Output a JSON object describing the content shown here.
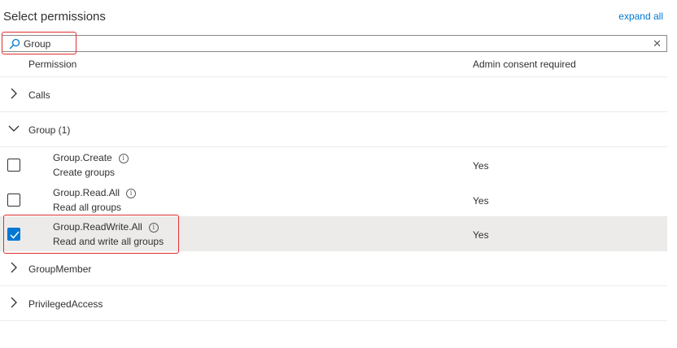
{
  "header": {
    "title": "Select permissions",
    "expand_all": "expand all"
  },
  "search": {
    "value": "Group",
    "clear_icon": "close-icon"
  },
  "columns": {
    "permission": "Permission",
    "admin_consent": "Admin consent required"
  },
  "groups": [
    {
      "label": "Calls",
      "expanded": false
    },
    {
      "label": "Group (1)",
      "expanded": true
    },
    {
      "label": "GroupMember",
      "expanded": false
    },
    {
      "label": "PrivilegedAccess",
      "expanded": false
    }
  ],
  "permissions": [
    {
      "name": "Group.Create",
      "description": "Create groups",
      "admin": "Yes",
      "checked": false
    },
    {
      "name": "Group.Read.All",
      "description": "Read all groups",
      "admin": "Yes",
      "checked": false
    },
    {
      "name": "Group.ReadWrite.All",
      "description": "Read and write all groups",
      "admin": "Yes",
      "checked": true
    }
  ],
  "colors": {
    "accent": "#0078d4",
    "highlight": "#e03030",
    "selected_row": "#edebe9"
  }
}
